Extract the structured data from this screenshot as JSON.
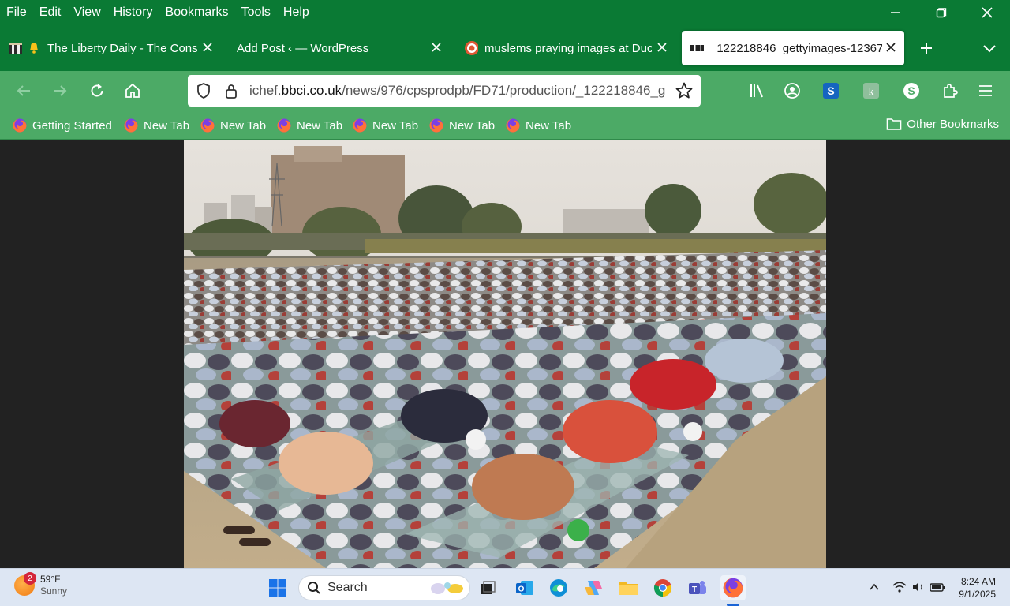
{
  "menu": [
    "File",
    "Edit",
    "View",
    "History",
    "Bookmarks",
    "Tools",
    "Help"
  ],
  "tabs": [
    {
      "title": "The Liberty Daily - The Conse",
      "active": false
    },
    {
      "title": "Add Post ‹ — WordPress",
      "active": false
    },
    {
      "title": "muslems praying images at Duck",
      "active": false
    },
    {
      "title": "_122218846_gettyimages-12367",
      "active": true
    }
  ],
  "urlbar": {
    "host_prefix": "ichef.",
    "host": "bbci.co.uk",
    "path": "/news/976/cpsprodpb/FD71/production/_122218846_g"
  },
  "bookmarks": [
    "Getting Started",
    "New Tab",
    "New Tab",
    "New Tab",
    "New Tab",
    "New Tab",
    "New Tab"
  ],
  "other_bookmarks": "Other Bookmarks",
  "taskbar": {
    "weather_temp": "59°F",
    "weather_cond": "Sunny",
    "weather_badge": "2",
    "search_label": "Search",
    "time": "8:24 AM",
    "date": "9/1/2025"
  },
  "colors": {
    "titlebar": "#0a7a34",
    "toolbar": "#4caa66",
    "taskbar": "#dde6f3"
  }
}
